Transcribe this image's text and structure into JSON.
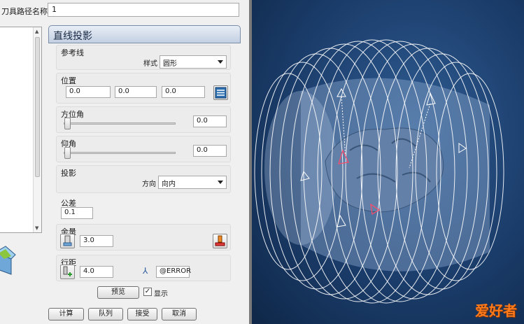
{
  "header": {
    "label": "刀具路径名称",
    "value": "1"
  },
  "panel": {
    "title": "直线投影"
  },
  "reference": {
    "group_label": "参考线",
    "style_label": "样式",
    "style_value": "圆形"
  },
  "position": {
    "group_label": "位置",
    "x": "0.0",
    "y": "0.0",
    "z": "0.0"
  },
  "azimuth": {
    "group_label": "方位角",
    "value": "0.0",
    "slider_fraction": 0.0
  },
  "elevation": {
    "group_label": "仰角",
    "value": "0.0",
    "slider_fraction": 0.0
  },
  "projection": {
    "group_label": "投影",
    "direction_label": "方向",
    "direction_value": "向内"
  },
  "tolerance": {
    "label": "公差",
    "value": "0.1"
  },
  "allowance": {
    "label": "余量",
    "value": "3.0"
  },
  "stepover": {
    "label": "行距",
    "value": "4.0",
    "expression": "@ERROR"
  },
  "preview": {
    "button_label": "预览",
    "show_label": "显示",
    "show_checked": true
  },
  "actions": {
    "compute": "计算",
    "queue": "队列",
    "accept": "接受",
    "cancel": "取消"
  },
  "viewport": {
    "watermark": "爱好者"
  },
  "colors": {
    "viewport_bg": "#1b3d6b",
    "title_bar": "#c3d0e2",
    "model": "#5f7ea8"
  }
}
